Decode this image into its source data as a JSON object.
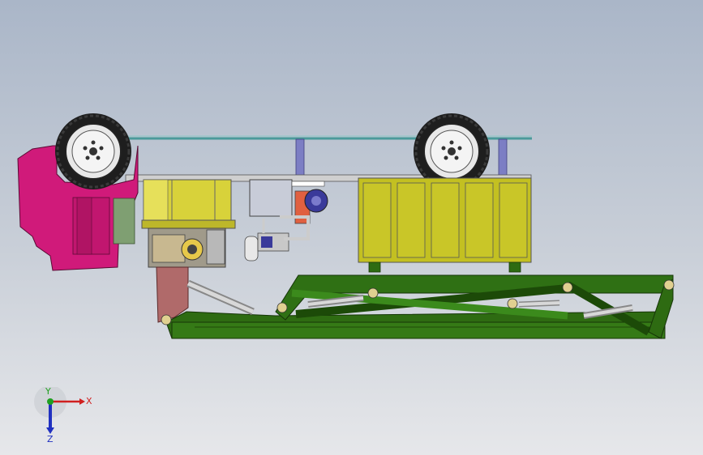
{
  "viewport": {
    "background_top": "#aab6c8",
    "background_bottom": "#e6e7ea"
  },
  "colors": {
    "frame_green": "#2e6b12",
    "frame_green_light": "#3f8a1c",
    "cab_magenta": "#d01a7a",
    "cab_magenta_dark": "#9a105a",
    "module_yellow": "#c9c11c",
    "module_yellow_light": "#dcd63a",
    "tank_yellow": "#c3c021",
    "bracket_brown": "#a86262",
    "tire": "#2b2b2b",
    "rod_blue": "#7c7ec4",
    "grey_block": "#8a8a8a",
    "platform_line": "#5ea6a6"
  },
  "triad": {
    "x_label": "X",
    "y_label": "Y",
    "z_label": "Z",
    "x_color": "#d02020",
    "y_color": "#20a020",
    "z_color": "#2030c0"
  }
}
